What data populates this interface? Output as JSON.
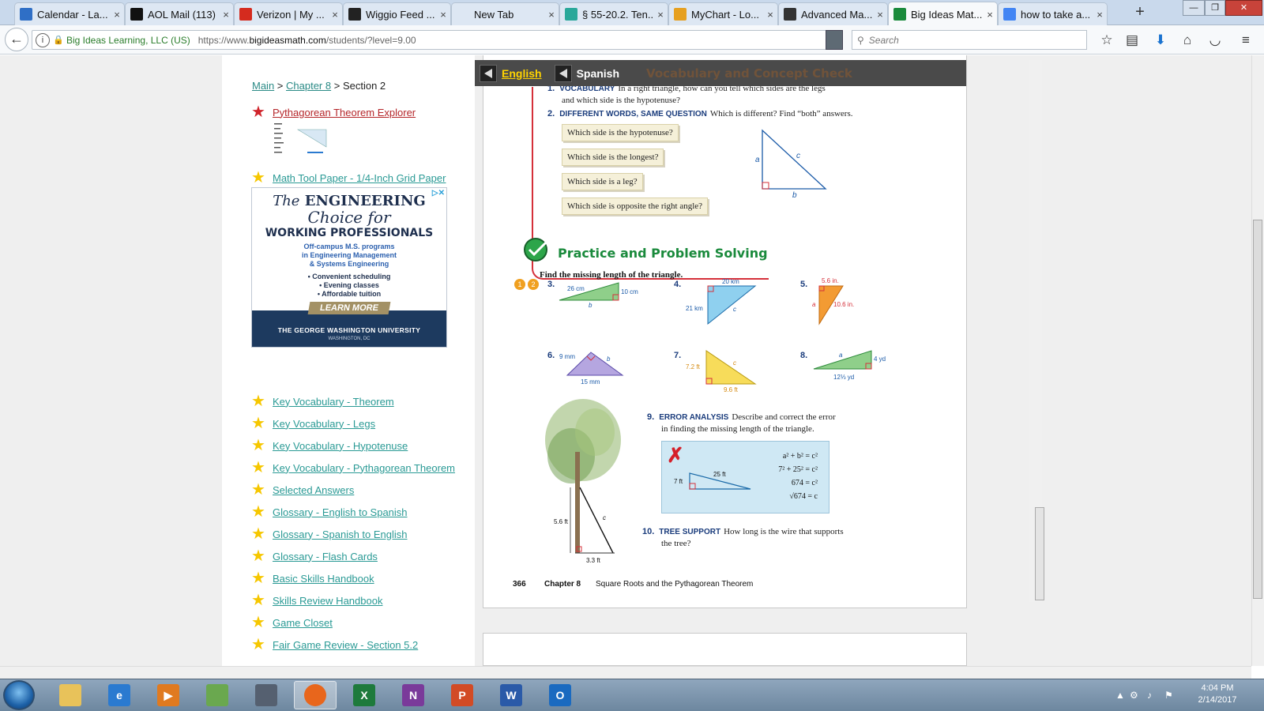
{
  "browser": {
    "tabs": [
      {
        "label": "Calendar - La...",
        "icon": "calendar-icon",
        "color": "#2f6fc6"
      },
      {
        "label": "AOL Mail (113)",
        "icon": "aol-icon",
        "color": "#111111"
      },
      {
        "label": "Verizon | My ...",
        "icon": "verizon-icon",
        "color": "#d52b1e"
      },
      {
        "label": "Wiggio Feed ...",
        "icon": "wiggio-icon",
        "color": "#222222"
      },
      {
        "label": "New Tab",
        "icon": "",
        "color": ""
      },
      {
        "label": "§ 55-20.2. Ten...",
        "icon": "site-icon",
        "color": "#2aa89a"
      },
      {
        "label": "MyChart - Lo...",
        "icon": "mychart-icon",
        "color": "#e6a020"
      },
      {
        "label": "Advanced Ma...",
        "icon": "bb-icon",
        "color": "#333333"
      },
      {
        "label": "Big Ideas Mat...",
        "icon": "bigideas-icon",
        "color": "#1a8a3c"
      },
      {
        "label": "how to take a...",
        "icon": "google-icon",
        "color": "#4285f4"
      }
    ],
    "new_tab": "+",
    "window_controls": {
      "minimize": "—",
      "restore": "❐",
      "close": "✕"
    },
    "back": "←",
    "identity": "Big Ideas Learning, LLC (US)",
    "url_prefix": "https://www.",
    "url_domain": "bigideasmath.com",
    "url_rest": "/students/?level=9.00",
    "search_placeholder": "Search"
  },
  "sidebar": {
    "breadcrumb": {
      "main": "Main",
      "sep1": " > ",
      "chapter": "Chapter 8",
      "sep2": " > ",
      "current": "Section 2"
    },
    "top_links": [
      {
        "label": "Pythagorean Theorem Explorer",
        "star": "red"
      },
      {
        "label": "Math Tool Paper - 1/4-Inch Grid Paper",
        "star": "gold"
      }
    ],
    "links": [
      "Key Vocabulary - Theorem",
      "Key Vocabulary - Legs",
      "Key Vocabulary - Hypotenuse",
      "Key Vocabulary - Pythagorean Theorem",
      "Selected Answers",
      "Glossary - English to Spanish",
      "Glossary - Spanish to English",
      "Glossary - Flash Cards",
      "Basic Skills Handbook",
      "Skills Review Handbook",
      "Game Closet",
      "Fair Game Review - Section 5.2"
    ]
  },
  "ad": {
    "the": "The",
    "engineering": "ENGINEERING",
    "choice": "Choice for",
    "working": "WORKING PROFESSIONALS",
    "programs": [
      "Off-campus M.S. programs",
      "in Engineering Management",
      "& Systems Engineering"
    ],
    "bullets": [
      "• Convenient scheduling",
      "• Evening classes",
      "• Affordable tuition"
    ],
    "cta": "LEARN MORE",
    "university": "THE GEORGE WASHINGTON UNIVERSITY",
    "location": "WASHINGTON, DC",
    "adchoices": "▷✕"
  },
  "book": {
    "lang_en": "English",
    "lang_es": "Spanish",
    "header_title": "Vocabulary and Concept Check",
    "q1_num": "1.",
    "q1_kw": "VOCABULARY",
    "q1_text": "In a right triangle, how can you tell which sides are the legs",
    "q1_text2": "and which side is the hypotenuse?",
    "q2_num": "2.",
    "q2_kw": "DIFFERENT WORDS, SAME QUESTION",
    "q2_text": "Which is different? Find “both” answers.",
    "q2_options": [
      "Which side is the hypotenuse?",
      "Which side is the longest?",
      "Which side is a leg?",
      "Which side is opposite the right angle?"
    ],
    "tri_labels": {
      "a": "a",
      "b": "b",
      "c": "c"
    },
    "section_title": "Practice and Problem Solving",
    "instruction": "Find the missing length of the triangle.",
    "badges": [
      "1",
      "2"
    ],
    "problems": [
      {
        "num": "3.",
        "labels": [
          "26 cm",
          "10 cm",
          "b"
        ]
      },
      {
        "num": "4.",
        "labels": [
          "20 km",
          "21 km",
          "c"
        ]
      },
      {
        "num": "5.",
        "labels": [
          "5.6 in.",
          "10.6 in.",
          "a"
        ]
      },
      {
        "num": "6.",
        "labels": [
          "9 mm",
          "15 mm",
          "b"
        ]
      },
      {
        "num": "7.",
        "labels": [
          "7.2 ft",
          "9.6 ft",
          "c"
        ]
      },
      {
        "num": "8.",
        "labels": [
          "4 yd",
          "12⅓ yd",
          "a"
        ]
      }
    ],
    "q9_num": "9.",
    "q9_kw": "ERROR ANALYSIS",
    "q9_text": "Describe and correct the error",
    "q9_text2": "in finding the missing length of the triangle.",
    "error_mark": "✗",
    "error_labels": [
      "7 ft",
      "25 ft"
    ],
    "error_work": [
      "a² + b² = c²",
      "7² + 25² = c²",
      "674 = c²",
      "√674 = c"
    ],
    "q10_num": "10.",
    "q10_kw": "TREE SUPPORT",
    "q10_text": "How long is the wire that supports",
    "q10_text2": "the tree?",
    "tree_labels": [
      "5.6 ft",
      "3.3 ft",
      "c"
    ],
    "page_num": "366",
    "chapter_label": "Chapter 8",
    "chapter_title": "Square Roots and the Pythagorean Theorem"
  },
  "taskbar": {
    "apps": [
      {
        "name": "explorer",
        "label": ""
      },
      {
        "name": "internet-explorer",
        "label": "e"
      },
      {
        "name": "media-player",
        "label": "▶"
      },
      {
        "name": "network",
        "label": ""
      },
      {
        "name": "drive",
        "label": ""
      },
      {
        "name": "firefox",
        "label": ""
      },
      {
        "name": "excel",
        "label": "X"
      },
      {
        "name": "onenote",
        "label": "N"
      },
      {
        "name": "powerpoint",
        "label": "P"
      },
      {
        "name": "word",
        "label": "W"
      },
      {
        "name": "outlook",
        "label": "O"
      }
    ],
    "time": "4:04 PM",
    "date": "2/14/2017"
  }
}
